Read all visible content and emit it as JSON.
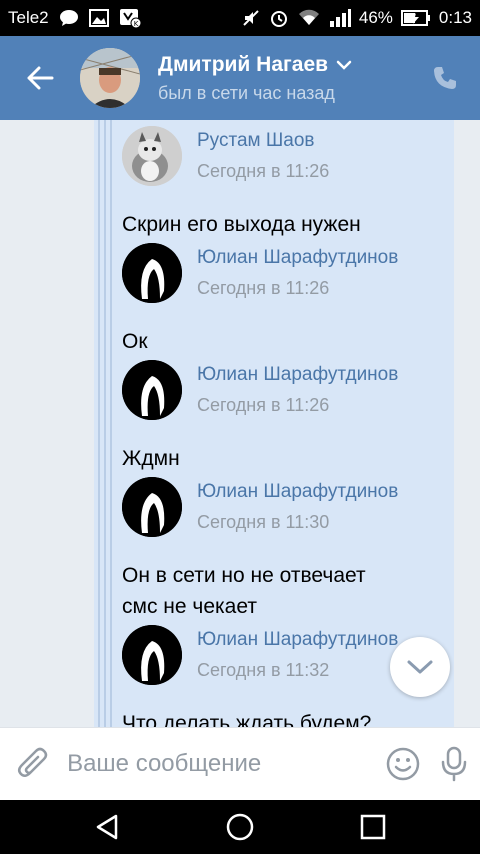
{
  "statusbar": {
    "carrier": "Tele2",
    "battery": "46%",
    "time": "0:13"
  },
  "header": {
    "name": "Дмитрий Нагаев",
    "status": "был в сети час назад"
  },
  "messages": [
    {
      "author": "Рустам Шаов",
      "time": "Сегодня в 11:26",
      "text": "Скрин его выхода нужен",
      "avatar": "cat-photo"
    },
    {
      "author": "Юлиан Шарафутдинов",
      "time": "Сегодня в 11:26",
      "text": "Ок",
      "avatar": "hood-photo"
    },
    {
      "author": "Юлиан Шарафутдинов",
      "time": "Сегодня в 11:26",
      "text": "Ждмн",
      "avatar": "hood-photo"
    },
    {
      "author": "Юлиан Шарафутдинов",
      "time": "Сегодня в 11:30",
      "text": "Он в сети но не отвечает\nсмс не чекает",
      "avatar": "hood-photo"
    },
    {
      "author": "Юлиан Шарафутдинов",
      "time": "Сегодня в 11:32",
      "text": "Что делать ждать будем?",
      "avatar": "hood-photo"
    }
  ],
  "input": {
    "placeholder": "Ваше сообщение",
    "value": ""
  },
  "colors": {
    "header": "#5181b8",
    "author": "#4a76a8",
    "forward_bg": "#d8e6f7"
  }
}
